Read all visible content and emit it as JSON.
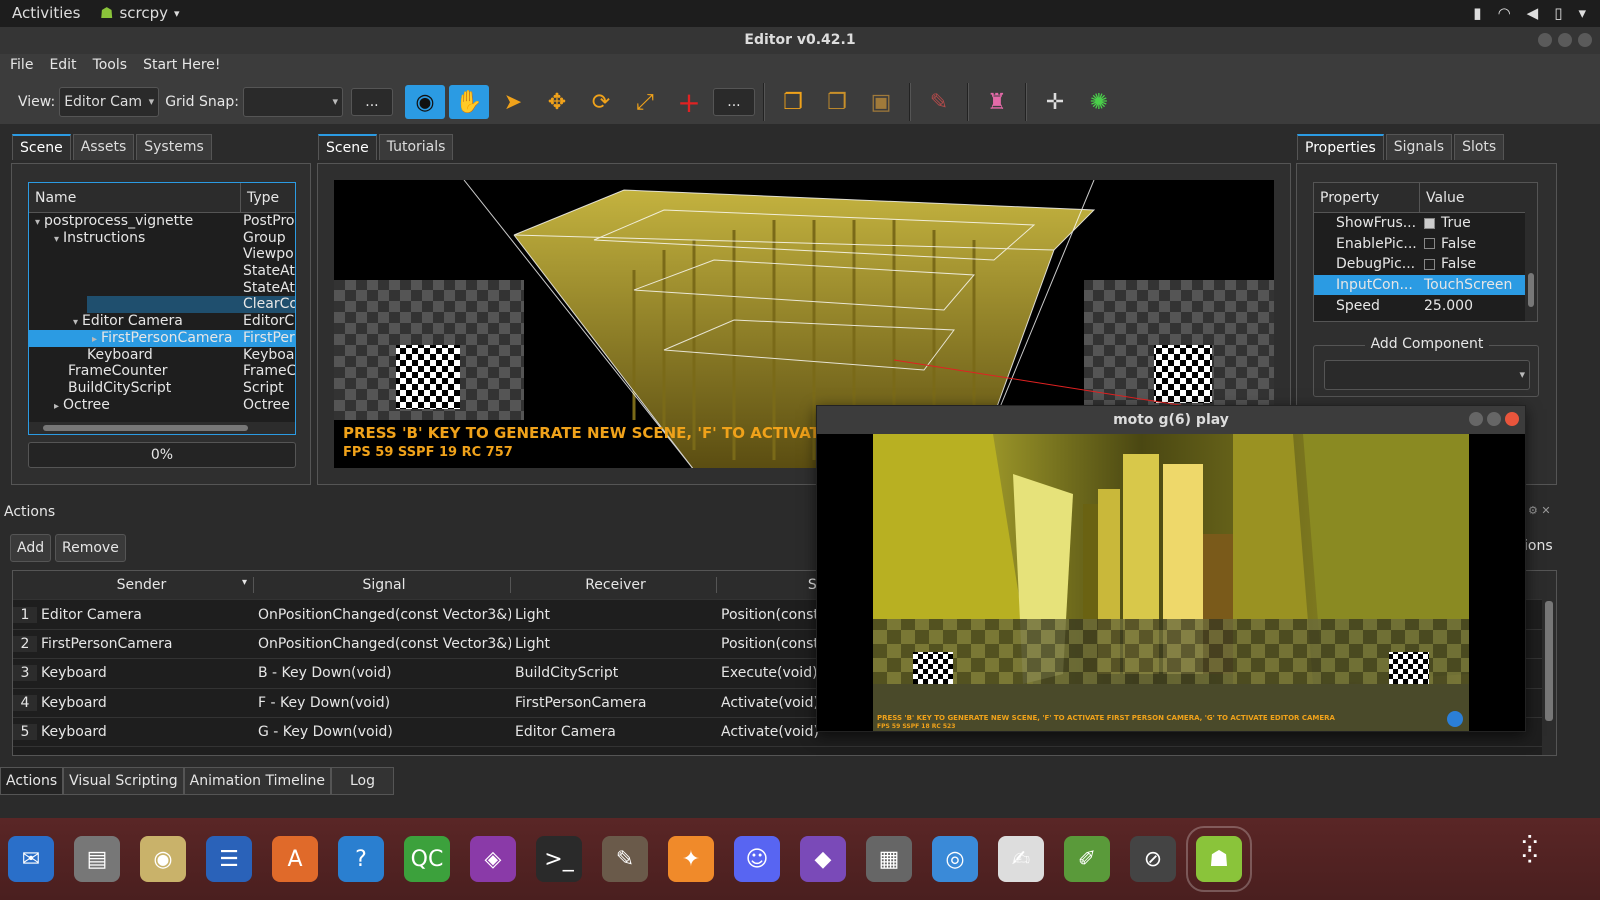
{
  "topbar": {
    "activities": "Activities",
    "app_name": "scrcpy",
    "tray_icons": [
      "camera-icon",
      "wifi-icon",
      "volume-icon",
      "battery-icon"
    ]
  },
  "window": {
    "title": "Editor v0.42.1"
  },
  "menu": [
    "File",
    "Edit",
    "Tools",
    "Start Here!"
  ],
  "toolbar": {
    "view_label": "View:",
    "view_value": "Editor Cam",
    "grid_snap_label": "Grid Snap:",
    "grid_snap_value": "",
    "more_label": "..."
  },
  "left_panel": {
    "tabs": [
      "Scene",
      "Assets",
      "Systems"
    ],
    "columns": [
      "Name",
      "Type"
    ],
    "rows": [
      {
        "name": "postprocess_vignette",
        "type": "PostPro",
        "indent": 0,
        "arrow": "down"
      },
      {
        "name": "Instructions",
        "type": "Group",
        "indent": 1,
        "arrow": "down"
      },
      {
        "name": "",
        "type": "Viewpo",
        "indent": 2,
        "arrow": ""
      },
      {
        "name": "",
        "type": "StateAt",
        "indent": 2,
        "arrow": ""
      },
      {
        "name": "",
        "type": "StateAt",
        "indent": 2,
        "arrow": ""
      },
      {
        "name": "",
        "type": "ClearCo",
        "indent": 2,
        "arrow": ""
      },
      {
        "name": "Editor Camera",
        "type": "EditorC",
        "indent": 2,
        "arrow": "down"
      },
      {
        "name": "FirstPersonCamera",
        "type": "FirstPer",
        "indent": 3,
        "arrow": "right"
      },
      {
        "name": "Keyboard",
        "type": "Keyboa",
        "indent": 2,
        "arrow": ""
      },
      {
        "name": "FrameCounter",
        "type": "FrameC",
        "indent": 1,
        "arrow": ""
      },
      {
        "name": "BuildCityScript",
        "type": "Script",
        "indent": 1,
        "arrow": ""
      },
      {
        "name": "Octree",
        "type": "Octree",
        "indent": 1,
        "arrow": "right"
      }
    ],
    "progress": "0%"
  },
  "center_panel": {
    "tabs": [
      "Scene",
      "Tutorials"
    ],
    "hud_line1": "PRESS 'B' KEY TO GENERATE NEW SCENE, 'F' TO ACTIVATE FIR",
    "hud_line2": "FPS 59 SSPF 19 RC 757"
  },
  "right_panel": {
    "tabs": [
      "Properties",
      "Signals",
      "Slots"
    ],
    "columns": [
      "Property",
      "Value"
    ],
    "rows": [
      {
        "property": "ShowFrus...",
        "value": "True",
        "check": true
      },
      {
        "property": "EnablePic...",
        "value": "False",
        "check": false
      },
      {
        "property": "DebugPic...",
        "value": "False",
        "check": false
      },
      {
        "property": "InputCon...",
        "value": "TouchScreen",
        "check": null
      },
      {
        "property": "Speed",
        "value": "25.000",
        "check": null
      }
    ],
    "add_component": "Add Component"
  },
  "actions": {
    "title": "Actions",
    "add": "Add",
    "remove": "Remove",
    "right_fragment": "ions",
    "columns": [
      "Sender",
      "Signal",
      "Receiver",
      "Slo"
    ],
    "rows": [
      {
        "n": "1",
        "sender": "Editor Camera",
        "signal": "OnPositionChanged(const Vector3&)",
        "receiver": "Light",
        "slot": "Position(const"
      },
      {
        "n": "2",
        "sender": "FirstPersonCamera",
        "signal": "OnPositionChanged(const Vector3&)",
        "receiver": "Light",
        "slot": "Position(const"
      },
      {
        "n": "3",
        "sender": "Keyboard",
        "signal": "B - Key Down(void)",
        "receiver": "BuildCityScript",
        "slot": "Execute(void)"
      },
      {
        "n": "4",
        "sender": "Keyboard",
        "signal": "F - Key Down(void)",
        "receiver": "FirstPersonCamera",
        "slot": "Activate(void)"
      },
      {
        "n": "5",
        "sender": "Keyboard",
        "signal": "G - Key Down(void)",
        "receiver": "Editor Camera",
        "slot": "Activate(void)"
      }
    ]
  },
  "bottom_tabs": [
    "Actions",
    "Visual Scripting",
    "Animation Timeline",
    "Log"
  ],
  "moto": {
    "title": "moto g(6) play",
    "hud_line1": "PRESS 'B' KEY TO GENERATE NEW SCENE, 'F' TO ACTIVATE FIRST PERSON CAMERA, 'G' TO ACTIVATE EDITOR CAMERA",
    "hud_line2": "FPS 59 SSPF 18 RC 523"
  },
  "dock": [
    {
      "name": "thunderbird-icon",
      "glyph": "✉",
      "color": "#2a6fc9"
    },
    {
      "name": "files-icon",
      "glyph": "▤",
      "color": "#777"
    },
    {
      "name": "rhythmbox-icon",
      "glyph": "◉",
      "color": "#c9b26a"
    },
    {
      "name": "writer-icon",
      "glyph": "☰",
      "color": "#2a62b9"
    },
    {
      "name": "software-icon",
      "glyph": "A",
      "color": "#e06a2a"
    },
    {
      "name": "help-icon",
      "glyph": "?",
      "color": "#2a7fd0"
    },
    {
      "name": "qtcreator-icon",
      "glyph": "QC",
      "color": "#3ca13c"
    },
    {
      "name": "video-icon",
      "glyph": "◈",
      "color": "#8a3aa8"
    },
    {
      "name": "terminal-icon",
      "glyph": ">_",
      "color": "#2a2a2a"
    },
    {
      "name": "gimp-icon",
      "glyph": "✎",
      "color": "#6a5a4a"
    },
    {
      "name": "blender-icon",
      "glyph": "✦",
      "color": "#f08a2a"
    },
    {
      "name": "discord-icon",
      "glyph": "☺",
      "color": "#5865f2"
    },
    {
      "name": "vs-icon",
      "glyph": "◆",
      "color": "#7a4ab8"
    },
    {
      "name": "calculator-icon",
      "glyph": "▦",
      "color": "#666"
    },
    {
      "name": "chrome-icon",
      "glyph": "◎",
      "color": "#3a8ad8"
    },
    {
      "name": "editor-icon",
      "glyph": "✍",
      "color": "#ddd"
    },
    {
      "name": "paint-icon",
      "glyph": "✐",
      "color": "#5a9a3a"
    },
    {
      "name": "scrcpy-icon",
      "glyph": "⊘",
      "color": "#444"
    },
    {
      "name": "android-icon",
      "glyph": "☗",
      "color": "#8ac43a"
    }
  ]
}
